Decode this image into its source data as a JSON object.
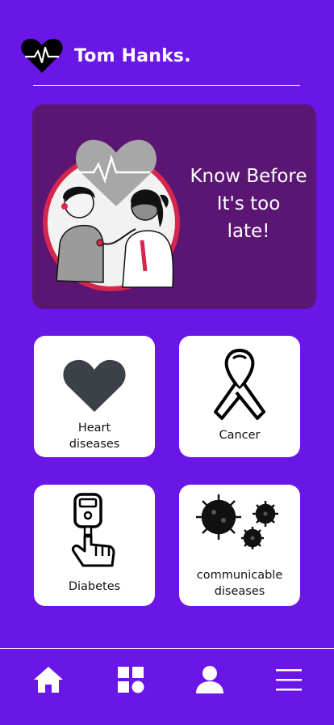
{
  "header": {
    "username": "Tom Hanks.",
    "logo_icon": "heartbeat-logo-icon"
  },
  "hero": {
    "text": "Know  Before\nIt's too\nlate!",
    "illustration": "doctor-patient-stethoscope-illustration"
  },
  "categories": [
    {
      "label": "Heart\ndiseases",
      "icon": "heart-icon"
    },
    {
      "label": "Cancer",
      "icon": "cancer-ribbon-icon"
    },
    {
      "label": "Diabetes",
      "icon": "glucose-meter-icon"
    },
    {
      "label": "communicable\ndiseases",
      "icon": "virus-icon"
    }
  ],
  "nav": [
    {
      "icon": "home-icon"
    },
    {
      "icon": "apps-grid-icon"
    },
    {
      "icon": "profile-icon"
    },
    {
      "icon": "menu-icon"
    }
  ],
  "colors": {
    "background": "#6a16e6",
    "hero_background": "#5a1672",
    "card_background": "#ffffff",
    "accent_red": "#d7264d"
  }
}
